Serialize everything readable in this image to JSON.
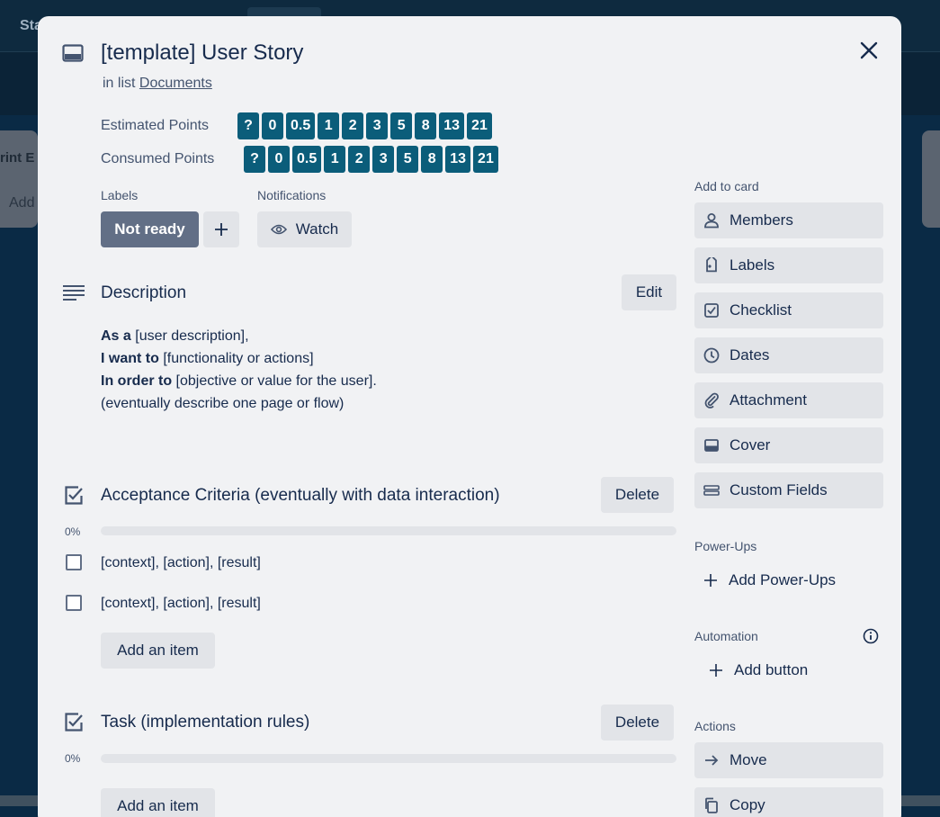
{
  "board": {
    "header_text": "Sta",
    "list_left_title": "rint E",
    "list_left_add": "Add"
  },
  "card": {
    "title": "[template] User Story",
    "in_list_prefix": "in list",
    "list_name": "Documents",
    "icon": "card-icon"
  },
  "custom_fields": {
    "estimated": {
      "label": "Estimated Points",
      "options": [
        "?",
        "0",
        "0.5",
        "1",
        "2",
        "3",
        "5",
        "8",
        "13",
        "21"
      ]
    },
    "consumed": {
      "label": "Consumed Points",
      "options": [
        "?",
        "0",
        "0.5",
        "1",
        "2",
        "3",
        "5",
        "8",
        "13",
        "21"
      ]
    },
    "chip_color": "#0b5d7a"
  },
  "labels": {
    "heading": "Labels",
    "items": [
      {
        "text": "Not ready",
        "color": "#626f86"
      }
    ],
    "add_icon": "plus-icon"
  },
  "notifications": {
    "heading": "Notifications",
    "watch_label": "Watch",
    "icon": "eye-icon"
  },
  "description": {
    "title": "Description",
    "edit_label": "Edit",
    "lines": [
      {
        "bold": "As a",
        "text": " [user description],"
      },
      {
        "bold": "I want to",
        "text": " [functionality or actions]"
      },
      {
        "bold": "In order to",
        "text": " [objective or value for the user]."
      },
      {
        "bold": "",
        "text": "(eventually describe one page or flow)"
      }
    ]
  },
  "checklists": [
    {
      "title": "Acceptance Criteria (eventually with data interaction)",
      "delete_label": "Delete",
      "progress": "0%",
      "progress_value": 0,
      "items": [
        "[context], [action], [result]",
        "[context], [action], [result]"
      ],
      "add_label": "Add an item"
    },
    {
      "title": "Task (implementation rules)",
      "delete_label": "Delete",
      "progress": "0%",
      "progress_value": 0,
      "items": [],
      "add_label": "Add an item"
    }
  ],
  "sidebar": {
    "add_to_card": {
      "heading": "Add to card",
      "buttons": [
        {
          "label": "Members",
          "icon": "person-icon"
        },
        {
          "label": "Labels",
          "icon": "tag-icon"
        },
        {
          "label": "Checklist",
          "icon": "checklist-icon"
        },
        {
          "label": "Dates",
          "icon": "clock-icon"
        },
        {
          "label": "Attachment",
          "icon": "paperclip-icon"
        },
        {
          "label": "Cover",
          "icon": "cover-icon"
        },
        {
          "label": "Custom Fields",
          "icon": "custom-fields-icon"
        }
      ]
    },
    "power_ups": {
      "heading": "Power-Ups",
      "add_label": "Add Power-Ups"
    },
    "automation": {
      "heading": "Automation",
      "add_label": "Add button"
    },
    "actions": {
      "heading": "Actions",
      "buttons": [
        {
          "label": "Move",
          "icon": "arrow-right-icon"
        },
        {
          "label": "Copy",
          "icon": "copy-icon"
        }
      ]
    }
  }
}
